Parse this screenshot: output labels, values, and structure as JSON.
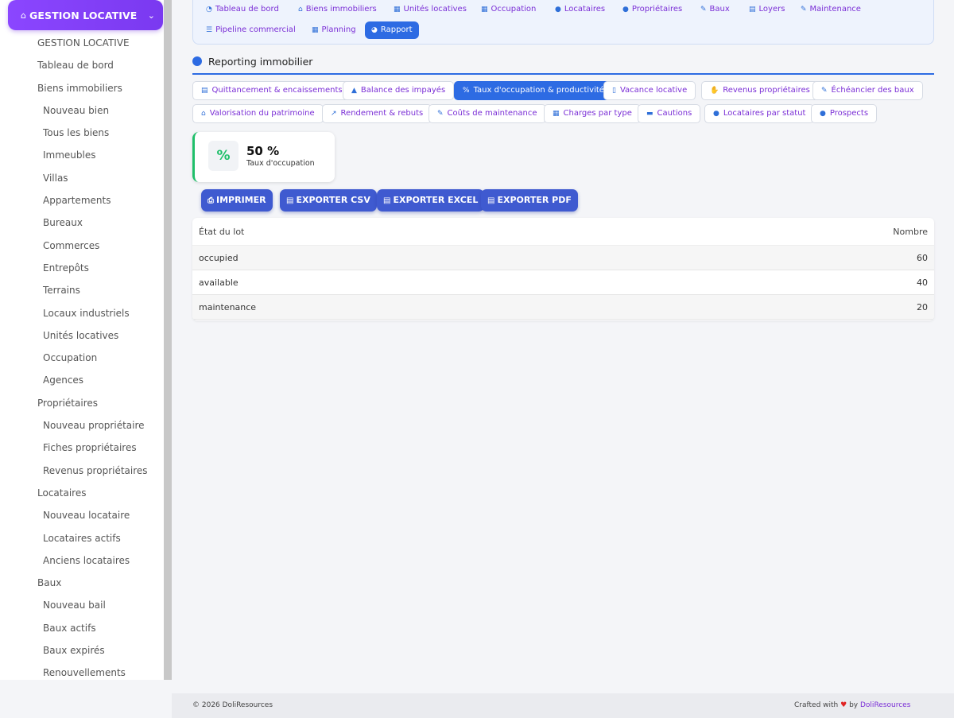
{
  "sidebar": {
    "module_title": "GESTION LOCATIVE",
    "items": [
      {
        "label": "GESTION LOCATIVE",
        "sub": false
      },
      {
        "label": "Tableau de bord",
        "sub": false
      },
      {
        "label": "Biens immobiliers",
        "sub": false
      },
      {
        "label": "Nouveau bien",
        "sub": true
      },
      {
        "label": "Tous les biens",
        "sub": true
      },
      {
        "label": "Immeubles",
        "sub": true
      },
      {
        "label": "Villas",
        "sub": true
      },
      {
        "label": "Appartements",
        "sub": true
      },
      {
        "label": "Bureaux",
        "sub": true
      },
      {
        "label": "Commerces",
        "sub": true
      },
      {
        "label": "Entrepôts",
        "sub": true
      },
      {
        "label": "Terrains",
        "sub": true
      },
      {
        "label": "Locaux industriels",
        "sub": true
      },
      {
        "label": "Unités locatives",
        "sub": true
      },
      {
        "label": "Occupation",
        "sub": true
      },
      {
        "label": "Agences",
        "sub": true
      },
      {
        "label": "Propriétaires",
        "sub": false
      },
      {
        "label": "Nouveau propriétaire",
        "sub": true
      },
      {
        "label": "Fiches propriétaires",
        "sub": true
      },
      {
        "label": "Revenus propriétaires",
        "sub": true
      },
      {
        "label": "Locataires",
        "sub": false
      },
      {
        "label": "Nouveau locataire",
        "sub": true
      },
      {
        "label": "Locataires actifs",
        "sub": true
      },
      {
        "label": "Anciens locataires",
        "sub": true
      },
      {
        "label": "Baux",
        "sub": false
      },
      {
        "label": "Nouveau bail",
        "sub": true
      },
      {
        "label": "Baux actifs",
        "sub": true
      },
      {
        "label": "Baux expirés",
        "sub": true
      },
      {
        "label": "Renouvellements",
        "sub": true
      }
    ]
  },
  "topnav": {
    "items": [
      {
        "label": "Tableau de bord",
        "icon": "gauge-icon",
        "glyph": "◔",
        "active": false
      },
      {
        "label": "Biens immobiliers",
        "icon": "home-icon",
        "glyph": "⌂",
        "active": false
      },
      {
        "label": "Unités locatives",
        "icon": "grid-icon",
        "glyph": "▦",
        "active": false
      },
      {
        "label": "Occupation",
        "icon": "table-icon",
        "glyph": "▦",
        "active": false
      },
      {
        "label": "Locataires",
        "icon": "user-icon",
        "glyph": "●",
        "active": false
      },
      {
        "label": "Propriétaires",
        "icon": "users-icon",
        "glyph": "●",
        "active": false
      },
      {
        "label": "Baux",
        "icon": "edit-icon",
        "glyph": "✎",
        "active": false
      },
      {
        "label": "Loyers",
        "icon": "file-icon",
        "glyph": "▤",
        "active": false
      },
      {
        "label": "Maintenance",
        "icon": "wrench-icon",
        "glyph": "✎",
        "active": false
      },
      {
        "label": "Pipeline commercial",
        "icon": "list-icon",
        "glyph": "☰",
        "active": false
      },
      {
        "label": "Planning",
        "icon": "calendar-icon",
        "glyph": "▦",
        "active": false
      },
      {
        "label": "Rapport",
        "icon": "pie-chart-icon",
        "glyph": "◕",
        "active": true
      }
    ]
  },
  "section": {
    "title": "Reporting immobilier"
  },
  "report_tabs": [
    {
      "label": "Quittancement & encaissements",
      "icon": "file-invoice-icon",
      "glyph": "▤",
      "active": false
    },
    {
      "label": "Balance des impayés",
      "icon": "warning-icon",
      "glyph": "▲",
      "active": false
    },
    {
      "label": "Taux d'occupation & productivité",
      "icon": "percent-icon",
      "glyph": "%",
      "active": true
    },
    {
      "label": "Vacance locative",
      "icon": "door-icon",
      "glyph": "▯",
      "active": false
    },
    {
      "label": "Revenus propriétaires",
      "icon": "hand-coins-icon",
      "glyph": "✋",
      "active": false
    },
    {
      "label": "Échéancier des baux",
      "icon": "edit-icon",
      "glyph": "✎",
      "active": false
    },
    {
      "label": "Valorisation du patrimoine",
      "icon": "home-icon",
      "glyph": "⌂",
      "active": false
    },
    {
      "label": "Rendement & rebuts",
      "icon": "line-chart-icon",
      "glyph": "↗",
      "active": false
    },
    {
      "label": "Coûts de maintenance",
      "icon": "wrench-icon",
      "glyph": "✎",
      "active": false
    },
    {
      "label": "Charges par type",
      "icon": "calculator-icon",
      "glyph": "▦",
      "active": false
    },
    {
      "label": "Cautions",
      "icon": "money-icon",
      "glyph": "▬",
      "active": false
    },
    {
      "label": "Locataires par statut",
      "icon": "user-icon",
      "glyph": "●",
      "active": false
    },
    {
      "label": "Prospects",
      "icon": "user-plus-icon",
      "glyph": "●",
      "active": false
    }
  ],
  "kpi": {
    "value": "50 %",
    "label": "Taux d'occupation",
    "icon": "percent-icon",
    "glyph": "%",
    "accent": "#1fbf6a"
  },
  "buttons": [
    {
      "label": "IMPRIMER",
      "icon": "print-icon",
      "glyph": "⎙"
    },
    {
      "label": "EXPORTER CSV",
      "icon": "file-csv-icon",
      "glyph": "▤"
    },
    {
      "label": "EXPORTER EXCEL",
      "icon": "file-excel-icon",
      "glyph": "▤"
    },
    {
      "label": "EXPORTER PDF",
      "icon": "file-pdf-icon",
      "glyph": "▤"
    }
  ],
  "table": {
    "headers": [
      "État du lot",
      "Nombre"
    ],
    "rows": [
      [
        "occupied",
        "60"
      ],
      [
        "available",
        "40"
      ],
      [
        "maintenance",
        "20"
      ]
    ]
  },
  "footer": {
    "copyright": "© 2026 DoliResources",
    "crafted": "Crafted with",
    "heart": "♥",
    "by": "by",
    "brand": "DoliResources"
  },
  "colors": {
    "accent": "#2d6be3",
    "purple": "#7b2fd6",
    "header_gradient_start": "#8b46ff",
    "success": "#1fbf6a"
  }
}
